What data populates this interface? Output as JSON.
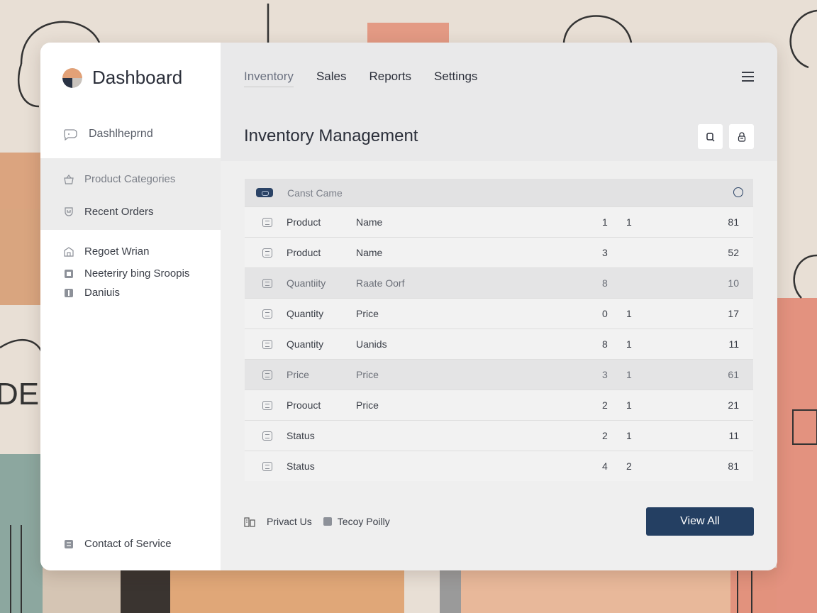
{
  "sidebar": {
    "brand": "Dashboard",
    "items": [
      {
        "label": "Dashlheprnd",
        "icon": "chat-icon"
      },
      {
        "label": "Product Categories",
        "icon": "basket-icon"
      },
      {
        "label": "Recent Orders",
        "icon": "shield-icon"
      },
      {
        "label": "Regoet Wrian",
        "icon": "store-icon"
      },
      {
        "label": "Neeteriry bing Sroopis",
        "icon": "box-icon"
      },
      {
        "label": "Daniuis",
        "icon": "tag-icon"
      }
    ],
    "contact": "Contact of Service"
  },
  "nav": {
    "tabs": [
      "Inventory",
      "Sales",
      "Reports",
      "Settings"
    ],
    "active": "Inventory"
  },
  "page": {
    "title": "Inventory Management"
  },
  "table": {
    "header": "Canst Came",
    "rows": [
      {
        "c1": "Product",
        "c2": "Name",
        "c3": "1",
        "c4": "1",
        "c5": "81",
        "hl": false
      },
      {
        "c1": "Product",
        "c2": "Name",
        "c3": "3",
        "c4": "",
        "c5": "52",
        "hl": false
      },
      {
        "c1": "Quantiity",
        "c2": "Raate Oorf",
        "c3": "8",
        "c4": "",
        "c5": "10",
        "hl": true
      },
      {
        "c1": "Quantity",
        "c2": "Price",
        "c3": "0",
        "c4": "1",
        "c5": "17",
        "hl": false
      },
      {
        "c1": "Quantity",
        "c2": "Uanids",
        "c3": "8",
        "c4": "1",
        "c5": "11",
        "hl": false
      },
      {
        "c1": "Price",
        "c2": "Price",
        "c3": "3",
        "c4": "1",
        "c5": "61",
        "hl": true
      },
      {
        "c1": "Proouct",
        "c2": "Price",
        "c3": "2",
        "c4": "1",
        "c5": "21",
        "hl": false
      },
      {
        "c1": "Status",
        "c2": "",
        "c3": "2",
        "c4": "1",
        "c5": "11",
        "hl": false
      },
      {
        "c1": "Status",
        "c2": "",
        "c3": "4",
        "c4": "2",
        "c5": "81",
        "hl": false
      }
    ]
  },
  "footer": {
    "link1": "Privact Us",
    "link2": "Tecoy Poilly",
    "button": "View All"
  },
  "colors": {
    "accent": "#243f62",
    "background": "#e7ded4"
  },
  "background_art": {
    "text": "DEF"
  }
}
